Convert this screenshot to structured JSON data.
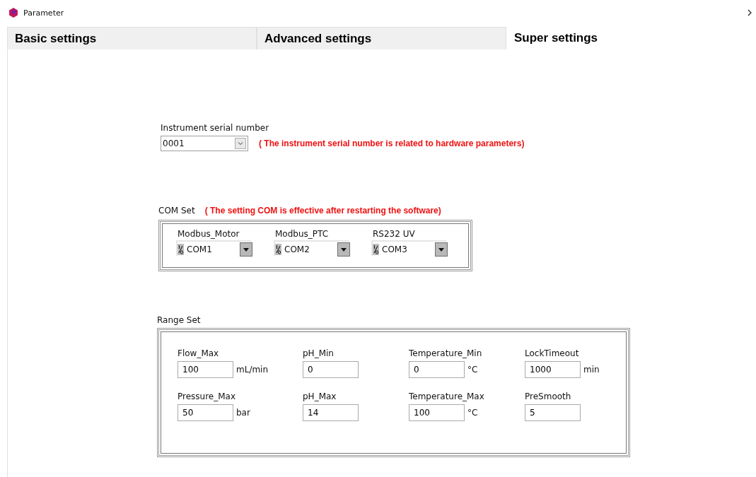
{
  "window": {
    "title": "Parameter"
  },
  "tabs": [
    {
      "label": "Basic settings",
      "selected": false
    },
    {
      "label": "Advanced settings",
      "selected": false
    },
    {
      "label": "Super settings",
      "selected": true
    }
  ],
  "serial": {
    "label": "Instrument serial number",
    "value": "0001",
    "note": "( The instrument serial number is related to hardware parameters)"
  },
  "com_set": {
    "label": "COM Set",
    "note": "( The setting COM is effective after restarting the software)",
    "ports": [
      {
        "label": "Modbus_Motor",
        "value": "COM1"
      },
      {
        "label": "Modbus_PTC",
        "value": "COM2"
      },
      {
        "label": "RS232 UV",
        "value": "COM3"
      }
    ]
  },
  "range_set": {
    "label": "Range Set",
    "fields": [
      {
        "label": "Flow_Max",
        "value": "100",
        "unit": "mL/min"
      },
      {
        "label": "pH_Min",
        "value": "0"
      },
      {
        "label": "Temperature_Min",
        "value": "0",
        "unit": "°C"
      },
      {
        "label": "LockTimeout",
        "value": "1000",
        "unit": "min"
      },
      {
        "label": "Pressure_Max",
        "value": "50",
        "unit": "bar"
      },
      {
        "label": "pH_Max",
        "value": "14"
      },
      {
        "label": "Temperature_Max",
        "value": "100",
        "unit": "°C"
      },
      {
        "label": "PreSmooth",
        "value": "5"
      }
    ]
  }
}
